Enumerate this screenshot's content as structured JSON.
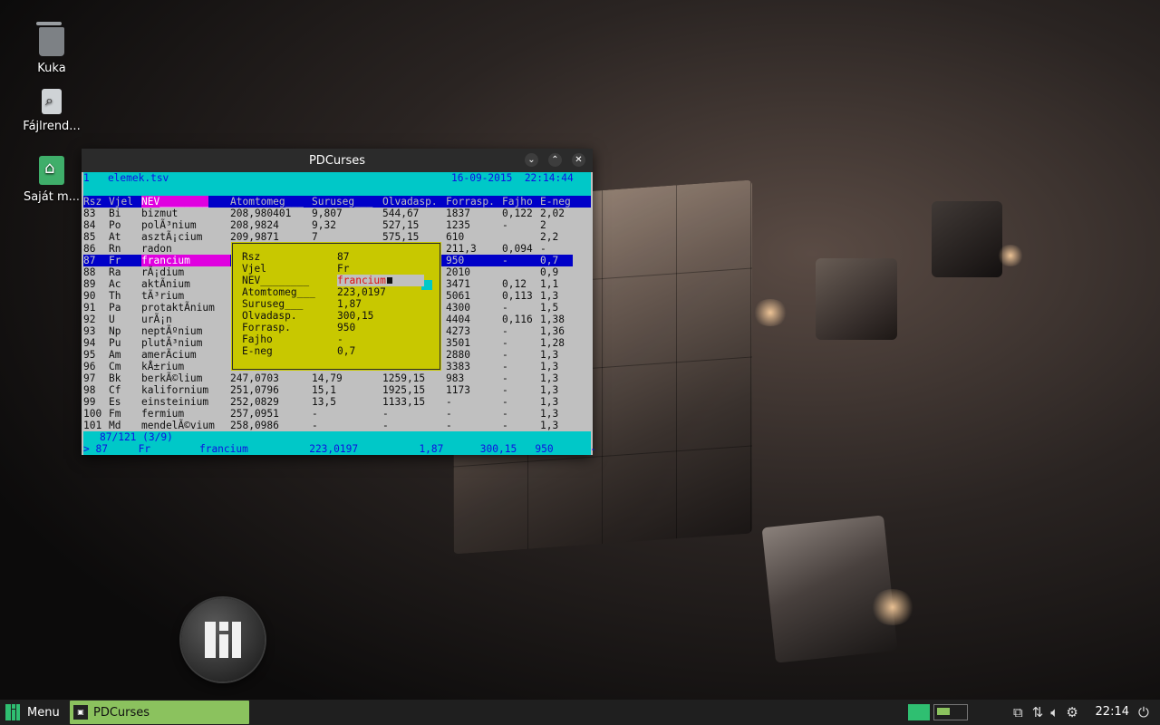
{
  "desktop": {
    "icons": [
      {
        "label": "Kuka",
        "icon": "trash-icon"
      },
      {
        "label": "Fájlrend...",
        "icon": "filesystem-icon"
      },
      {
        "label": "Saját m...",
        "icon": "home-folder-icon"
      }
    ]
  },
  "window": {
    "title": "PDCurses",
    "buttons": [
      "minimize",
      "maximize",
      "close"
    ]
  },
  "terminal": {
    "top_left": "1   elemek.tsv",
    "top_date": "16-09-2015  22:14:44",
    "columns": [
      "Rsz",
      "Vjel",
      "NEV________",
      "Atomtomeg___",
      "Suruseg___",
      "Olvadasp.",
      "Forrasp.",
      "Fajho",
      "E-neg"
    ],
    "rows": [
      [
        "83",
        "Bi",
        "bizmut",
        "208,980401",
        "9,807",
        "544,67",
        "1837",
        "0,122",
        "2,02"
      ],
      [
        "84",
        "Po",
        "polÃ³nium",
        "208,9824",
        "9,32",
        "527,15",
        "1235",
        "-",
        "2"
      ],
      [
        "85",
        "At",
        "asztÃ¡cium",
        "209,9871",
        "7",
        "575,15",
        "610",
        "",
        "2,2"
      ],
      [
        "86",
        "Rn",
        "radon",
        "",
        "",
        "",
        "211,3",
        "0,094",
        "-"
      ],
      [
        "87",
        "Fr",
        "francium",
        "",
        "",
        "",
        "950",
        "-",
        "0,7"
      ],
      [
        "88",
        "Ra",
        "rÃ¡dium",
        "",
        "",
        "",
        "2010",
        "",
        "0,9"
      ],
      [
        "89",
        "Ac",
        "aktÃ­nium",
        "",
        "",
        "",
        "3471",
        "0,12",
        "1,1"
      ],
      [
        "90",
        "Th",
        "tÃ³rium",
        "",
        "",
        "",
        "5061",
        "0,113",
        "1,3"
      ],
      [
        "91",
        "Pa",
        "protaktÃ­nium",
        "",
        "",
        "",
        "4300",
        "-",
        "1,5"
      ],
      [
        "92",
        "U",
        "urÃ¡n",
        "",
        "",
        "",
        "4404",
        "0,116",
        "1,38"
      ],
      [
        "93",
        "Np",
        "neptÃºnium",
        "",
        "",
        "",
        "4273",
        "-",
        "1,36"
      ],
      [
        "94",
        "Pu",
        "plutÃ³nium",
        "",
        "",
        "",
        "3501",
        "-",
        "1,28"
      ],
      [
        "95",
        "Am",
        "amerÃ­cium",
        "",
        "",
        "",
        "2880",
        "-",
        "1,3"
      ],
      [
        "96",
        "Cm",
        "kÅ±rium",
        "",
        "",
        "",
        "3383",
        "-",
        "1,3"
      ],
      [
        "97",
        "Bk",
        "berkÃ©lium",
        "247,0703",
        "14,79",
        "1259,15",
        "983",
        "-",
        "1,3"
      ],
      [
        "98",
        "Cf",
        "kalifornium",
        "251,0796",
        "15,1",
        "1925,15",
        "1173",
        "-",
        "1,3"
      ],
      [
        "99",
        "Es",
        "einsteinium",
        "252,0829",
        "13,5",
        "1133,15",
        "-",
        "-",
        "1,3"
      ],
      [
        "100",
        "Fm",
        "fermium",
        "257,0951",
        "-",
        "-",
        "-",
        "-",
        "1,3"
      ],
      [
        "101",
        "Md",
        "mendelÃ©vium",
        "258,0986",
        "-",
        "-",
        "-",
        "-",
        "1,3"
      ]
    ],
    "popup": [
      {
        "label": "Rsz",
        "value": "87"
      },
      {
        "label": "Vjel",
        "value": "Fr"
      },
      {
        "label": "NEV________",
        "value": "francium"
      },
      {
        "label": "Atomtomeg___",
        "value": "223,0197"
      },
      {
        "label": "Suruseg___",
        "value": "1,87"
      },
      {
        "label": "Olvadasp.",
        "value": "300,15"
      },
      {
        "label": "Forrasp.",
        "value": "950"
      },
      {
        "label": "Fajho",
        "value": "-"
      },
      {
        "label": "E-neg",
        "value": "0,7"
      }
    ],
    "status_position": "87/121 (3/9)",
    "status_line": "> 87     Fr        francium          223,0197          1,87      300,15   950      -"
  },
  "taskbar": {
    "menu_label": "Menu",
    "task_label": "PDCurses",
    "clock": "22:14"
  },
  "colors": {
    "terminal_bg": "#c0c0c0",
    "cyan": "#00c8c8",
    "blue": "#0000c8",
    "magenta": "#e000e0",
    "popup_yellow": "#c8c800",
    "taskbar_green": "#8bc25e"
  }
}
